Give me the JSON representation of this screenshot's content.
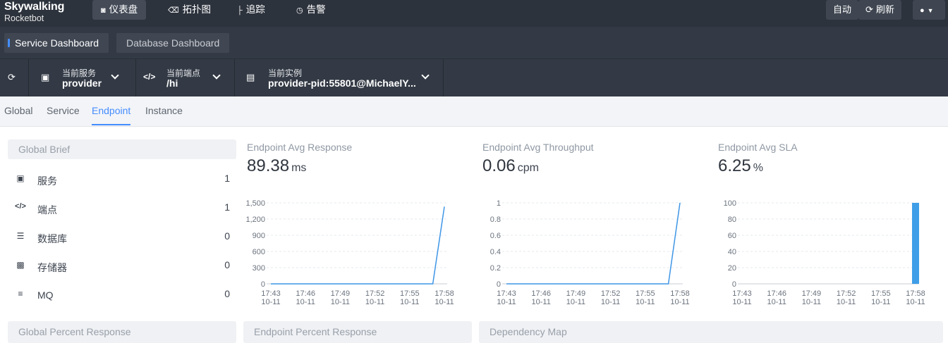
{
  "app": {
    "logo": "Skywalking",
    "logo_sub": "Rocketbot"
  },
  "nav": [
    {
      "label": "仪表盘",
      "icon": "chart-icon",
      "active": true
    },
    {
      "label": "拓扑图",
      "icon": "topology-icon",
      "active": false
    },
    {
      "label": "追踪",
      "icon": "trace-icon",
      "active": false
    },
    {
      "label": "告警",
      "icon": "alarm-icon",
      "active": false
    }
  ],
  "toolbar": {
    "auto_label": "自动",
    "refresh_label": "刷新"
  },
  "dashboards": [
    {
      "label": "Service Dashboard",
      "active": true
    },
    {
      "label": "Database Dashboard",
      "active": false
    }
  ],
  "selectors": {
    "service": {
      "label": "当前服务",
      "value": "provider"
    },
    "endpoint": {
      "label": "当前端点",
      "value": "/hi"
    },
    "instance": {
      "label": "当前实例",
      "value": "provider-pid:55801@MichaelY..."
    }
  },
  "tabs": [
    {
      "label": "Global",
      "active": false
    },
    {
      "label": "Service",
      "active": false
    },
    {
      "label": "Endpoint",
      "active": true
    },
    {
      "label": "Instance",
      "active": false
    }
  ],
  "brief": {
    "title": "Global Brief",
    "items": [
      {
        "label": "服务",
        "value": "1",
        "icon": "service-icon"
      },
      {
        "label": "端点",
        "value": "1",
        "icon": "code-icon"
      },
      {
        "label": "数据库",
        "value": "0",
        "icon": "database-icon"
      },
      {
        "label": "存储器",
        "value": "0",
        "icon": "storage-icon"
      },
      {
        "label": "MQ",
        "value": "0",
        "icon": "mq-icon"
      }
    ]
  },
  "metrics": [
    {
      "title": "Endpoint Avg Response",
      "value": "89.38",
      "unit": "ms"
    },
    {
      "title": "Endpoint Avg Throughput",
      "value": "0.06",
      "unit": "cpm"
    },
    {
      "title": "Endpoint Avg SLA",
      "value": "6.25",
      "unit": "%"
    }
  ],
  "panels": {
    "global_percent": "Global Percent Response",
    "endpoint_percent": "Endpoint Percent Response",
    "dependency_map": "Dependency Map"
  },
  "chart_data": [
    {
      "type": "line",
      "title": "Endpoint Avg Response",
      "x": [
        "17:43",
        "17:44",
        "17:45",
        "17:46",
        "17:47",
        "17:48",
        "17:49",
        "17:50",
        "17:51",
        "17:52",
        "17:53",
        "17:54",
        "17:55",
        "17:56",
        "17:57",
        "17:58"
      ],
      "x_ticks": [
        "17:43",
        "17:46",
        "17:49",
        "17:52",
        "17:55",
        "17:58"
      ],
      "x_sub": "10-11",
      "y_ticks": [
        "0",
        "300",
        "600",
        "900",
        "1,200",
        "1,500"
      ],
      "ylim": [
        0,
        1500
      ],
      "series": [
        {
          "values": [
            0,
            0,
            0,
            0,
            0,
            0,
            0,
            0,
            0,
            0,
            0,
            0,
            0,
            0,
            0,
            1430
          ]
        }
      ],
      "color": "#3f96e6",
      "grid": true
    },
    {
      "type": "line",
      "title": "Endpoint Avg Throughput",
      "x": [
        "17:43",
        "17:44",
        "17:45",
        "17:46",
        "17:47",
        "17:48",
        "17:49",
        "17:50",
        "17:51",
        "17:52",
        "17:53",
        "17:54",
        "17:55",
        "17:56",
        "17:57",
        "17:58"
      ],
      "x_ticks": [
        "17:43",
        "17:46",
        "17:49",
        "17:52",
        "17:55",
        "17:58"
      ],
      "x_sub": "10-11",
      "y_ticks": [
        "0",
        "0.2",
        "0.4",
        "0.6",
        "0.8",
        "1"
      ],
      "ylim": [
        0,
        1
      ],
      "series": [
        {
          "values": [
            0,
            0,
            0,
            0,
            0,
            0,
            0,
            0,
            0,
            0,
            0,
            0,
            0,
            0,
            0,
            1
          ]
        }
      ],
      "color": "#3f96e6",
      "grid": true
    },
    {
      "type": "bar",
      "title": "Endpoint Avg SLA",
      "x": [
        "17:43",
        "17:44",
        "17:45",
        "17:46",
        "17:47",
        "17:48",
        "17:49",
        "17:50",
        "17:51",
        "17:52",
        "17:53",
        "17:54",
        "17:55",
        "17:56",
        "17:57",
        "17:58"
      ],
      "x_ticks": [
        "17:43",
        "17:46",
        "17:49",
        "17:52",
        "17:55",
        "17:58"
      ],
      "x_sub": "10-11",
      "y_ticks": [
        "0",
        "20",
        "40",
        "60",
        "80",
        "100"
      ],
      "ylim": [
        0,
        100
      ],
      "series": [
        {
          "values": [
            0,
            0,
            0,
            0,
            0,
            0,
            0,
            0,
            0,
            0,
            0,
            0,
            0,
            0,
            0,
            100
          ]
        }
      ],
      "color": "#3f9ee8",
      "grid": true
    }
  ]
}
